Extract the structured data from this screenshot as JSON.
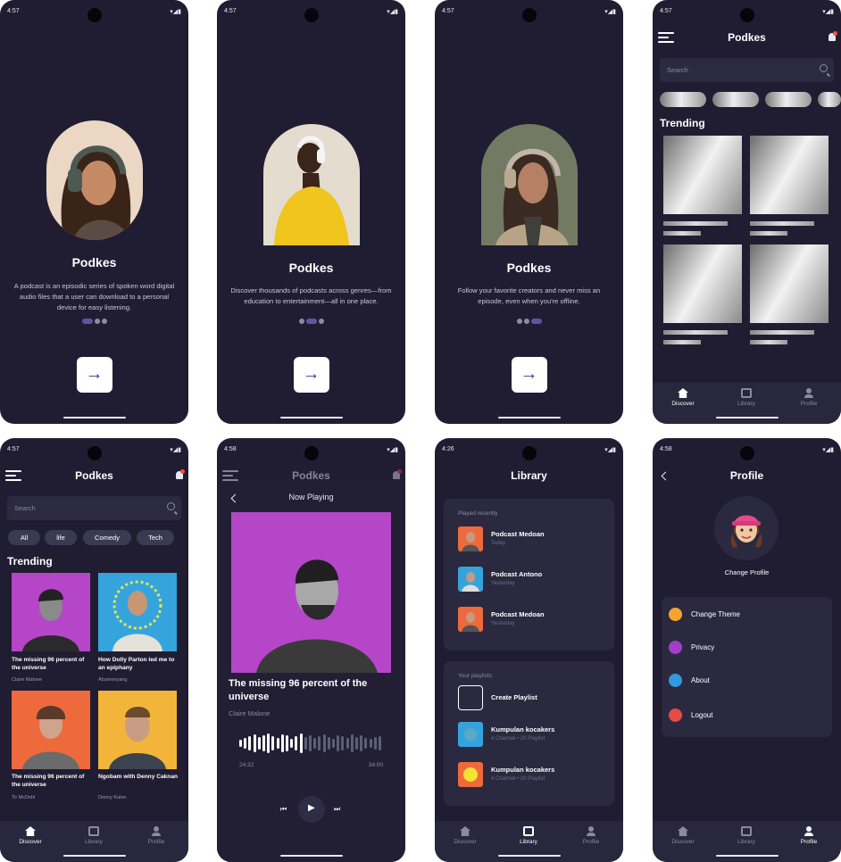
{
  "status": {
    "time_a": "4:57",
    "time_b": "4:58",
    "time_c": "4:26",
    "icons": "▾◢▮"
  },
  "onboarding": [
    {
      "title": "Podkes",
      "desc": "A podcast is an episodic series of spoken word digital audio files that a user can download to a personal device for easy listening.",
      "active": 0
    },
    {
      "title": "Podkes",
      "desc": "Discover thousands of podcasts across genres—from education to entertainment—all in one place.",
      "active": 1
    },
    {
      "title": "Podkes",
      "desc": "Follow your favorite creators and never miss an episode, even when you're offline.",
      "active": 2
    }
  ],
  "arrow": "→",
  "discover": {
    "title": "Podkes",
    "search_placeholder": "Search",
    "chips": [
      "All",
      "life",
      "Comedy",
      "Tech"
    ],
    "section": "Trending",
    "cards": [
      {
        "title": "The missing 96 percent of the universe",
        "author": "Claire Malone"
      },
      {
        "title": "How Dolly Parton led me to an epiphany",
        "author": "Abumenyang"
      },
      {
        "title": "The missing 96 percent of the universe",
        "author": "Tir McDohl"
      },
      {
        "title": "Ngobam with Denny Caknan",
        "author": "Denny Kulon"
      }
    ]
  },
  "nav": {
    "discover": "Discover",
    "library": "Library",
    "profile": "Profile"
  },
  "now_playing": {
    "header": "Now Playing",
    "title": "The missing 96 percent of the universe",
    "author": "Claire Malone",
    "elapsed": "24:32",
    "total": "34:00",
    "played_fraction": 0.45,
    "prev": "⏮",
    "play": "▶",
    "next": "⏭"
  },
  "library": {
    "title": "Library",
    "recent_label": "Played recently",
    "recent": [
      {
        "name": "Podcast Medoan",
        "when": "Today"
      },
      {
        "name": "Podcast Antono",
        "when": "Yesterday"
      },
      {
        "name": "Podcast Medoan",
        "when": "Yesterday"
      }
    ],
    "playlist_label": "Your playlists",
    "create": "Create Playlist",
    "playlists": [
      {
        "name": "Kumpulan kocakers",
        "meta": "4 Channel • 20 Playlist"
      },
      {
        "name": "Kumpulan kocakers",
        "meta": "4 Channel • 20 Playlist"
      }
    ]
  },
  "profile": {
    "title": "Profile",
    "change_profile": "Change Profile",
    "menu": [
      "Change Theme",
      "Privacy",
      "About",
      "Logout"
    ]
  },
  "colors": {
    "bg": "#201d33",
    "accent": "#5a57a8",
    "card": "#2a2940"
  }
}
